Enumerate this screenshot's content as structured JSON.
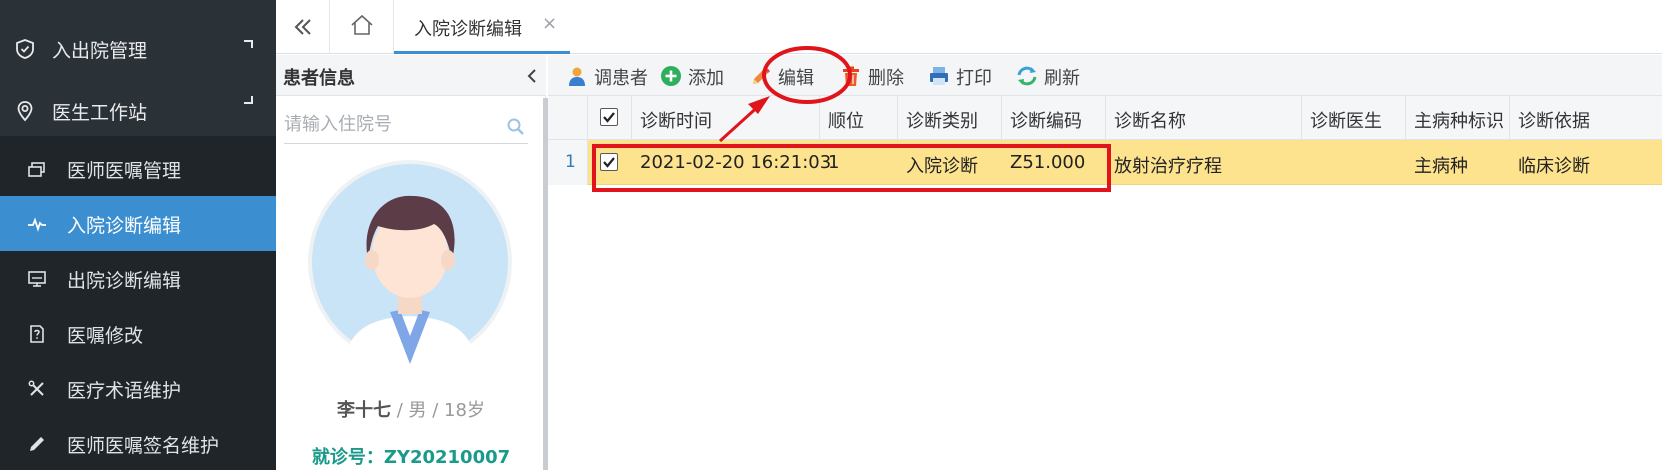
{
  "sidebar": {
    "groups": [
      {
        "label": "入出院管理",
        "icon": "shield-icon"
      },
      {
        "label": "医生工作站",
        "icon": "location-pin-icon"
      }
    ],
    "items": [
      {
        "label": "医师医嘱管理",
        "icon": "cards-icon"
      },
      {
        "label": "入院诊断编辑",
        "icon": "heartbeat-icon",
        "active": true
      },
      {
        "label": "出院诊断编辑",
        "icon": "monitor-icon"
      },
      {
        "label": "医嘱修改",
        "icon": "question-doc-icon"
      },
      {
        "label": "医疗术语维护",
        "icon": "tools-icon"
      },
      {
        "label": "医师医嘱签名维护",
        "icon": "pen-icon"
      }
    ]
  },
  "tabs": {
    "active_label": "入院诊断编辑",
    "close_glyph": "×"
  },
  "patient_panel": {
    "title": "患者信息",
    "search_placeholder": "请输入住院号",
    "name": "李十七",
    "gender": " / 男",
    "age": " / 18岁",
    "visit_label": "就诊号：",
    "visit_no": "ZY20210007"
  },
  "toolbar": {
    "buttons": [
      {
        "label": "调患者",
        "icon": "user-icon"
      },
      {
        "label": "添加",
        "icon": "add-icon"
      },
      {
        "label": "编辑",
        "icon": "pencil-icon"
      },
      {
        "label": "删除",
        "icon": "trash-icon"
      },
      {
        "label": "打印",
        "icon": "printer-icon"
      },
      {
        "label": "刷新",
        "icon": "refresh-icon"
      }
    ]
  },
  "grid": {
    "columns": [
      "诊断时间",
      "顺位",
      "诊断类别",
      "诊断编码",
      "诊断名称",
      "诊断医生",
      "主病种标识",
      "诊断依据"
    ],
    "rows": [
      {
        "num": "1",
        "checked": true,
        "cells": [
          "2021-02-20 16:21:03",
          "1",
          "入院诊断",
          "Z51.000",
          "放射治疗疗程",
          "",
          "主病种",
          "临床诊断"
        ]
      }
    ]
  },
  "colors": {
    "sidebar_bg": "#2b3237",
    "submenu_bg": "#1f2529",
    "active_item": "#3b8fd0",
    "selected_row": "#fde38d",
    "annotation_red": "#e0151b",
    "visit_no_teal": "#1a9a8a"
  }
}
